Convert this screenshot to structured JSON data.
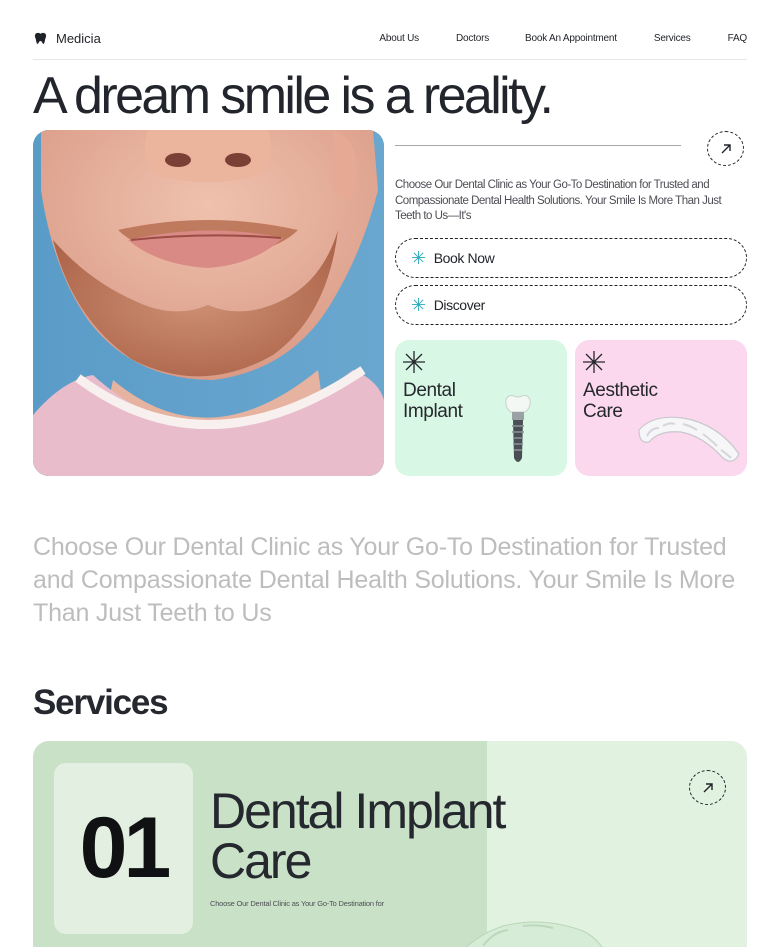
{
  "header": {
    "logo_text": "Medicia",
    "logo_icon": "tooth-icon",
    "nav": [
      "About Us",
      "Doctors",
      "Book An Appointment",
      "Services",
      "FAQ"
    ]
  },
  "hero": {
    "title": "A dream smile is a reality.",
    "intro": "Choose Our Dental Clinic as Your Go-To Destination for Trusted and Compassionate Dental Health Solutions. Your Smile Is More Than Just Teeth to Us—It's",
    "buttons": {
      "book": "Book Now",
      "discover": "Discover"
    },
    "cards": {
      "implant": "Dental Implant",
      "aesthetic": "Aesthetic Care"
    }
  },
  "lead": "Choose Our Dental Clinic as Your Go-To Destination for Trusted and Compassionate Dental Health Solutions. Your Smile Is More Than Just Teeth to Us",
  "services": {
    "title": "Services",
    "items": [
      {
        "number": "01",
        "title": "Dental Implant Care",
        "subtitle": "Choose Our Dental Clinic as Your Go-To Destination for"
      }
    ]
  },
  "colors": {
    "accent": "#2aa7b8",
    "implant_card": "#d8f7e4",
    "aesthetic_card": "#fcd8ef",
    "service_card": "#c9e2c7",
    "photo_bg": "#5d9dc7"
  }
}
